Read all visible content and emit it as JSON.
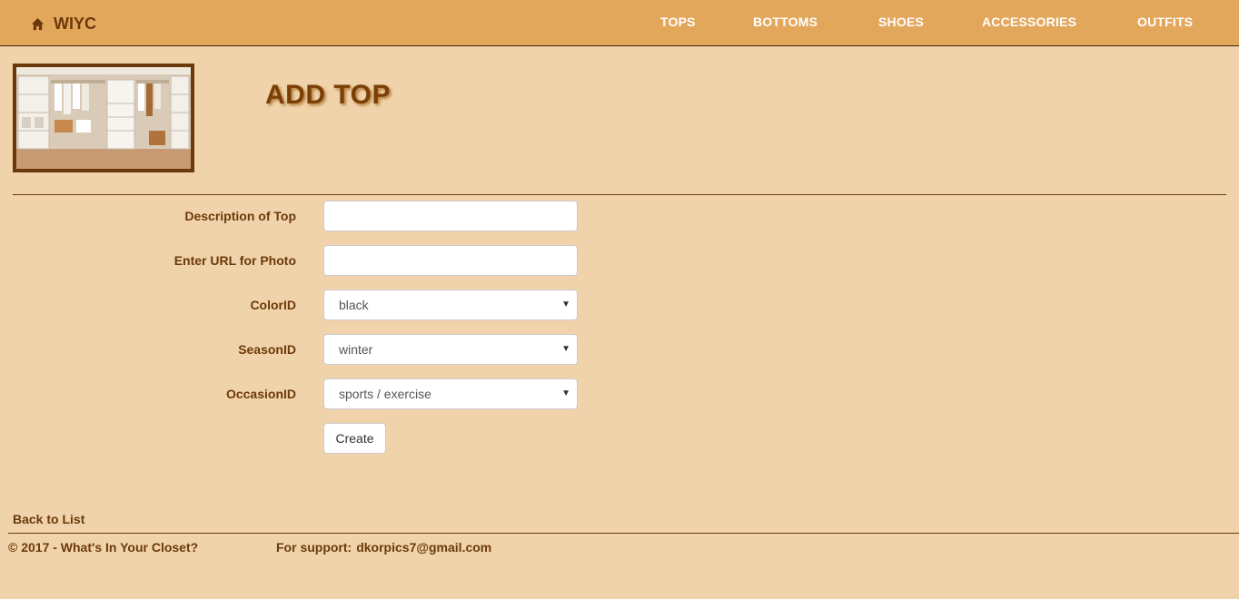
{
  "navbar": {
    "brand": "WIYC",
    "brand_icon": "home-icon",
    "items": [
      "TOPS",
      "BOTTOMS",
      "SHOES",
      "ACCESSORIES",
      "OUTFITS"
    ]
  },
  "header": {
    "logo_image": "closet-photo",
    "title": "ADD TOP"
  },
  "form": {
    "description_label": "Description of Top",
    "description_value": "",
    "photo_url_label": "Enter URL for Photo",
    "photo_url_value": "",
    "color_label": "ColorID",
    "color_value": "black",
    "season_label": "SeasonID",
    "season_value": "winter",
    "occasion_label": "OccasionID",
    "occasion_value": "sports / exercise",
    "submit_label": "Create"
  },
  "links": {
    "back": "Back to List"
  },
  "footer": {
    "copyright": "© 2017 - What's In Your Closet?",
    "support_label": "For support:",
    "support_email": "dkorpics7@gmail.com"
  },
  "colors": {
    "page_background": "#f0d3ab",
    "navbar_background": "#e3a75c",
    "text_brown": "#6b3a0a",
    "nav_text": "#ffffff"
  }
}
